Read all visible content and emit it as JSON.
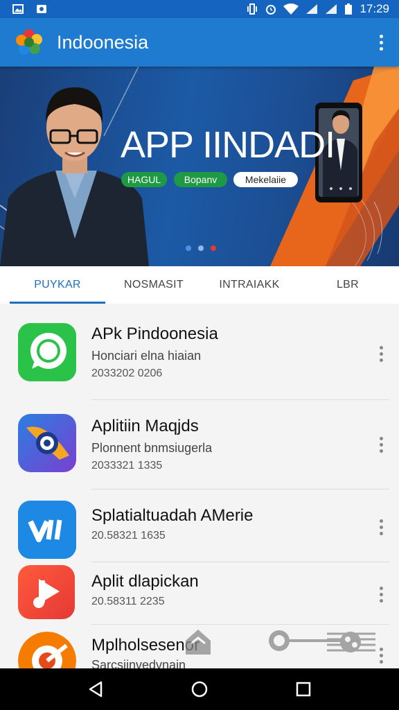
{
  "status_bar": {
    "time": "17:29",
    "icons": [
      "gallery-icon",
      "app-notification-icon",
      "vibrate-icon",
      "alarm-icon",
      "wifi-icon",
      "signal-icon",
      "signal-icon",
      "battery-icon"
    ]
  },
  "app_bar": {
    "title": "Indoonesia",
    "logo_icon": "colorful-flower-logo",
    "menu_icon": "more-vert-icon"
  },
  "banner": {
    "title": "APP IINDADI",
    "tags": [
      "HAGUL",
      "Bopanv",
      "Mekelaiie"
    ],
    "dots": 3,
    "active_dot": 2
  },
  "tabs": [
    {
      "label": "PUYKAR",
      "active": true
    },
    {
      "label": "NOSMASIT",
      "active": false
    },
    {
      "label": "INTRAIAKK",
      "active": false
    },
    {
      "label": "LBR",
      "active": false
    }
  ],
  "apps": [
    {
      "title": "APk Pindoonesia",
      "subtitle": "Honciari elna hiaian",
      "date": "2033202 0206",
      "icon": "chat-bubble-icon"
    },
    {
      "title": "Aplitiin Maqjds",
      "subtitle": "Plonnent bnmsiugerla",
      "date": "2033321 1335",
      "icon": "lens-icon"
    },
    {
      "title": "Splatialtuadah AMerie",
      "subtitle": "",
      "date": "20.58321 1635",
      "icon": "logo-lines-icon"
    },
    {
      "title": "Aplit dlapickan",
      "subtitle": "",
      "date": "20.58311 2235",
      "icon": "music-play-icon"
    },
    {
      "title": "Mplholsesenor",
      "subtitle": "Sarcsiinvedvnain",
      "date": "",
      "icon": "disc-icon"
    }
  ],
  "colors": {
    "status_bar": "#1565c0",
    "app_bar": "#1e7bd0",
    "accent": "#1e6fc0",
    "tag_green": "#1f9a44"
  },
  "nav": [
    "back-icon",
    "home-icon",
    "recents-icon"
  ]
}
